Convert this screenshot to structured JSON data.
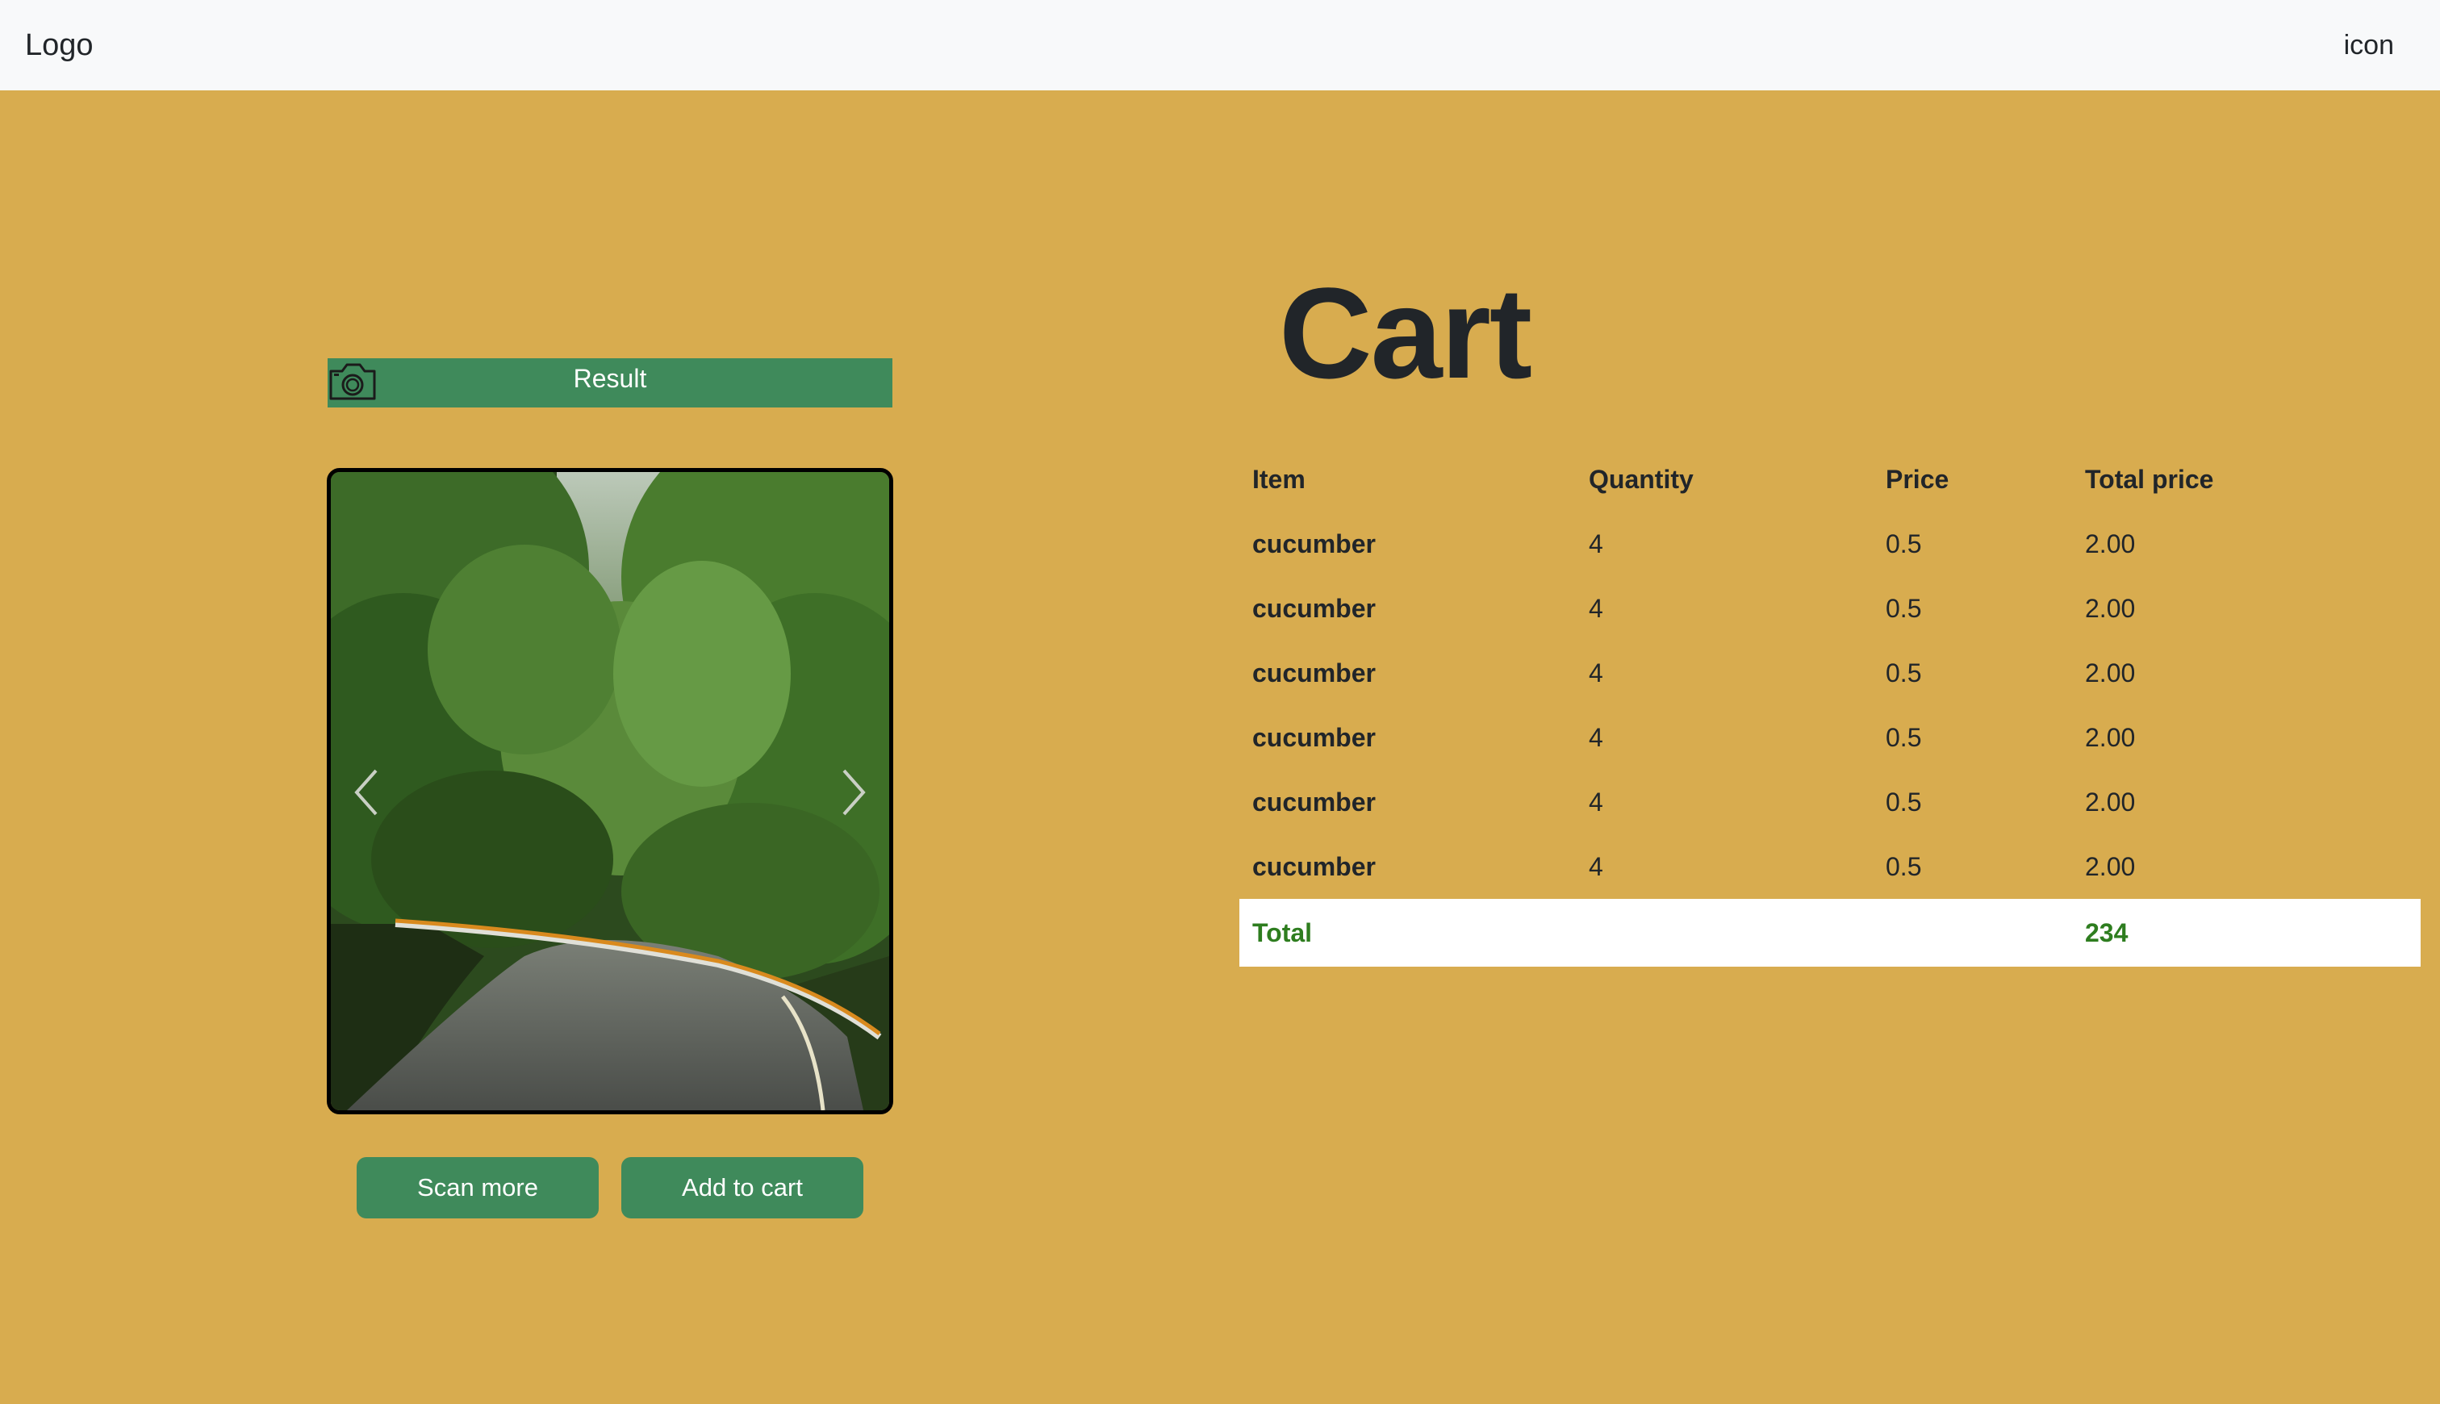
{
  "navbar": {
    "logo": "Logo",
    "icon_label": "icon"
  },
  "result": {
    "title": "Result",
    "camera_icon": "camera-icon"
  },
  "carousel": {
    "prev_icon": "chevron-left-icon",
    "next_icon": "chevron-right-icon"
  },
  "buttons": {
    "scan_more": "Scan more",
    "add_to_cart": "Add to cart"
  },
  "cart": {
    "title": "Cart",
    "headers": [
      "Item",
      "Quantity",
      "Price",
      "Total price"
    ],
    "rows": [
      {
        "item": "cucumber",
        "quantity": "4",
        "price": "0.5",
        "total": "2.00"
      },
      {
        "item": "cucumber",
        "quantity": "4",
        "price": "0.5",
        "total": "2.00"
      },
      {
        "item": "cucumber",
        "quantity": "4",
        "price": "0.5",
        "total": "2.00"
      },
      {
        "item": "cucumber",
        "quantity": "4",
        "price": "0.5",
        "total": "2.00"
      },
      {
        "item": "cucumber",
        "quantity": "4",
        "price": "0.5",
        "total": "2.00"
      },
      {
        "item": "cucumber",
        "quantity": "4",
        "price": "0.5",
        "total": "2.00"
      }
    ],
    "total_label": "Total",
    "total_value": "234"
  },
  "colors": {
    "background": "#d8ac4f",
    "accent": "#3f8a5b",
    "total_text": "#2e7d1f",
    "navbar": "#f8f9fa"
  }
}
